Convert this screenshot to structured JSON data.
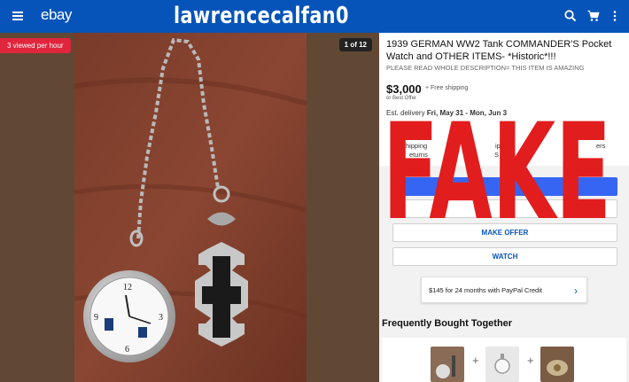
{
  "header": {
    "logo": "ebay",
    "watermark_user": "lawrencecalfan0",
    "menu_icon": "hamburger-menu-icon",
    "search_icon": "search-icon",
    "cart_icon": "cart-icon",
    "more_icon": "more-vert-icon",
    "bg_color": "#0654ba"
  },
  "gallery": {
    "viewed_badge": "3 viewed per hour",
    "image_counter": "1 of 12"
  },
  "listing": {
    "title": "1939 GERMAN WW2 Tank COMMANDER'S Pocket Watch and OTHER ITEMS- *Historic*!!!",
    "subtitle": "PLEASE READ WHOLE DESCRIPTION= THIS ITEM IS AMAZING",
    "price": "$3,000",
    "shipping": "+ Free shipping",
    "best_offer": "or Best Offer",
    "delivery_prefix": "Est. delivery ",
    "delivery_dates": "Fri, May 31 - Mon, Jun 3"
  },
  "features": {
    "ship_fragment": "hipping",
    "returns_fragment": "eturns",
    "ships_fragment": "ips f",
    "s_fragment": "S",
    "ers_fragment": "ers"
  },
  "actions": {
    "buy_fragment": "UY",
    "add_fragment": "D",
    "make_offer": "MAKE OFFER",
    "watch": "WATCH"
  },
  "credit": {
    "text": "$145 for 24 months with PayPal Credit",
    "chevron_icon": "chevron-right-icon"
  },
  "fbt": {
    "title": "Frequently Bought Together"
  },
  "overlay": {
    "fake_text": "FAKE",
    "color": "#e21d1d"
  }
}
